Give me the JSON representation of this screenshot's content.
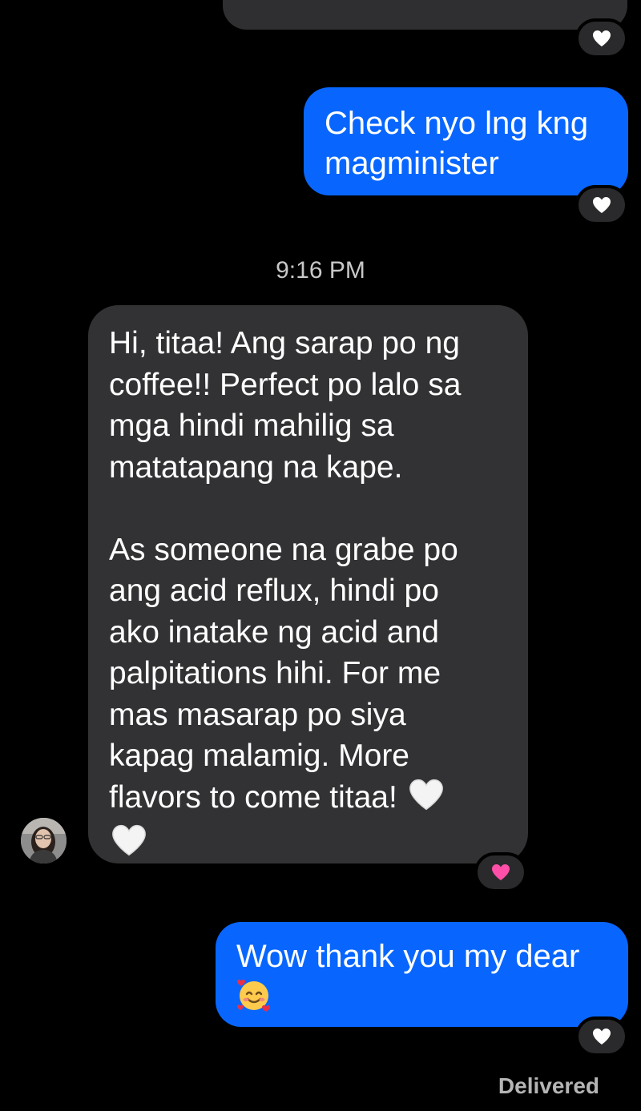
{
  "conversation": {
    "messages": [
      {
        "id": "m1",
        "sender": "me",
        "text": "Check nyo lng kng\nmagminister",
        "reaction": "white-heart"
      },
      {
        "id": "m2",
        "sender": "contact",
        "timestamp": "9:16 PM",
        "text": "Hi, titaa! Ang sarap po ng\ncoffee!! Perfect po lalo sa\nmga hindi mahilig sa\nmatatapang na kape.\n\nAs someone na grabe po\nang acid reflux, hindi po\nako inatake ng acid and\npalpitations hihi. For me\nmas masarap po siya\nkapag malamig. More\nflavors to come titaa!",
        "trailing_emoji": [
          "white-heart",
          "white-heart"
        ],
        "reaction": "pink-heart"
      },
      {
        "id": "m3",
        "sender": "me",
        "text": "Wow thank you my dear",
        "trailing_emoji": [
          "smiling-face-with-hearts"
        ],
        "reaction": "white-heart"
      }
    ],
    "status": "Delivered"
  },
  "colors": {
    "background": "#000000",
    "sent_bubble": "#0866ff",
    "received_bubble": "#323234",
    "reaction_pill": "#2a2a2c",
    "pink_heart": "#ff4fa8"
  },
  "icons": {
    "reaction_prev": "white-heart-icon",
    "avatar": "contact-avatar"
  }
}
